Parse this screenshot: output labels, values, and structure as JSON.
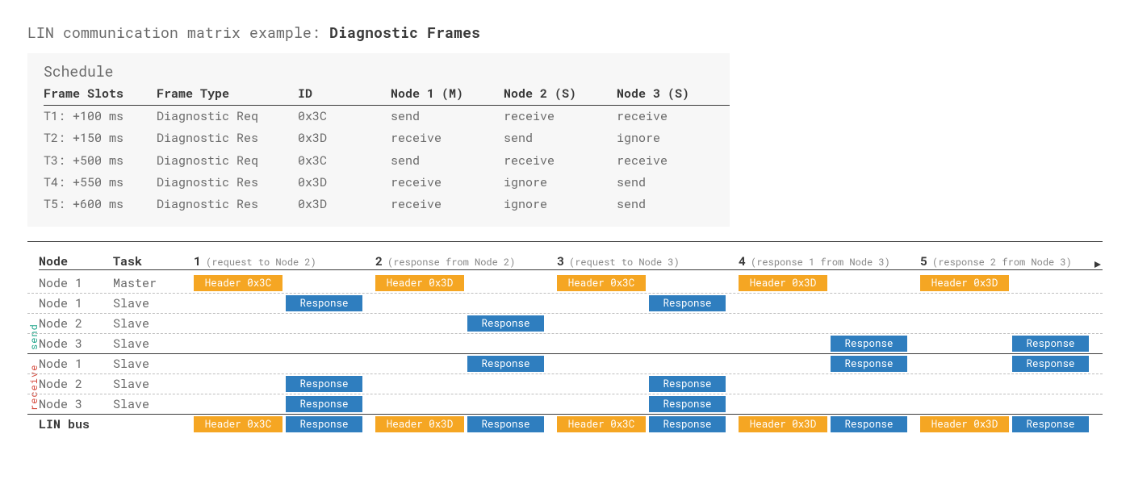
{
  "title_prefix": "LIN communication matrix example: ",
  "title_strong": "Diagnostic Frames",
  "schedule": {
    "title": "Schedule",
    "headers": [
      "Frame Slots",
      "Frame Type",
      "ID",
      "Node 1 (M)",
      "Node 2 (S)",
      "Node 3 (S)"
    ],
    "rows": [
      {
        "slot": "T1: +100 ms",
        "type": "Diagnostic Req",
        "id": "0x3C",
        "n1": {
          "v": "send",
          "c": "send"
        },
        "n2": {
          "v": "receive",
          "c": "recv"
        },
        "n3": {
          "v": "receive",
          "c": "recv"
        }
      },
      {
        "slot": "T2: +150 ms",
        "type": "Diagnostic Res",
        "id": "0x3D",
        "n1": {
          "v": "receive",
          "c": "recv"
        },
        "n2": {
          "v": "send",
          "c": "send"
        },
        "n3": {
          "v": "ignore",
          "c": "ign"
        }
      },
      {
        "slot": "T3: +500 ms",
        "type": "Diagnostic Req",
        "id": "0x3C",
        "n1": {
          "v": "send",
          "c": "send"
        },
        "n2": {
          "v": "receive",
          "c": "recv"
        },
        "n3": {
          "v": "receive",
          "c": "recv"
        }
      },
      {
        "slot": "T4: +550 ms",
        "type": "Diagnostic Res",
        "id": "0x3D",
        "n1": {
          "v": "receive",
          "c": "recv"
        },
        "n2": {
          "v": "ignore",
          "c": "ign"
        },
        "n3": {
          "v": "send",
          "c": "send"
        }
      },
      {
        "slot": "T5: +600 ms",
        "type": "Diagnostic Res",
        "id": "0x3D",
        "n1": {
          "v": "receive",
          "c": "recv"
        },
        "n2": {
          "v": "ignore",
          "c": "ign"
        },
        "n3": {
          "v": "send",
          "c": "send"
        }
      }
    ]
  },
  "timeline": {
    "head": {
      "node": "Node",
      "task": "Task"
    },
    "slots": [
      {
        "num": "1",
        "desc": "(request to Node 2)",
        "header": "Header 0x3C"
      },
      {
        "num": "2",
        "desc": "(response from Node 2)",
        "header": "Header 0x3D"
      },
      {
        "num": "3",
        "desc": "(request to Node 3)",
        "header": "Header 0x3C"
      },
      {
        "num": "4",
        "desc": "(response 1 from Node 3)",
        "header": "Header 0x3D"
      },
      {
        "num": "5",
        "desc": "(response 2 from Node 3)",
        "header": "Header 0x3D"
      }
    ],
    "resp_label": "Response",
    "flag_send": "send",
    "flag_recv": "receive",
    "rows": {
      "master": {
        "node": "Node 1",
        "task": "Master"
      },
      "send1": {
        "node": "Node 1",
        "task": "Slave",
        "resp": [
          true,
          false,
          true,
          false,
          false
        ]
      },
      "send2": {
        "node": "Node 2",
        "task": "Slave",
        "resp": [
          false,
          true,
          false,
          false,
          false
        ]
      },
      "send3": {
        "node": "Node 3",
        "task": "Slave",
        "resp": [
          false,
          false,
          false,
          true,
          true
        ]
      },
      "recv1": {
        "node": "Node 1",
        "task": "Slave",
        "resp": [
          false,
          true,
          false,
          true,
          true
        ]
      },
      "recv2": {
        "node": "Node 2",
        "task": "Slave",
        "resp": [
          true,
          false,
          true,
          false,
          false
        ]
      },
      "recv3": {
        "node": "Node 3",
        "task": "Slave",
        "resp": [
          true,
          false,
          true,
          false,
          false
        ]
      },
      "linbus": {
        "node": "LIN bus",
        "task": ""
      }
    }
  }
}
